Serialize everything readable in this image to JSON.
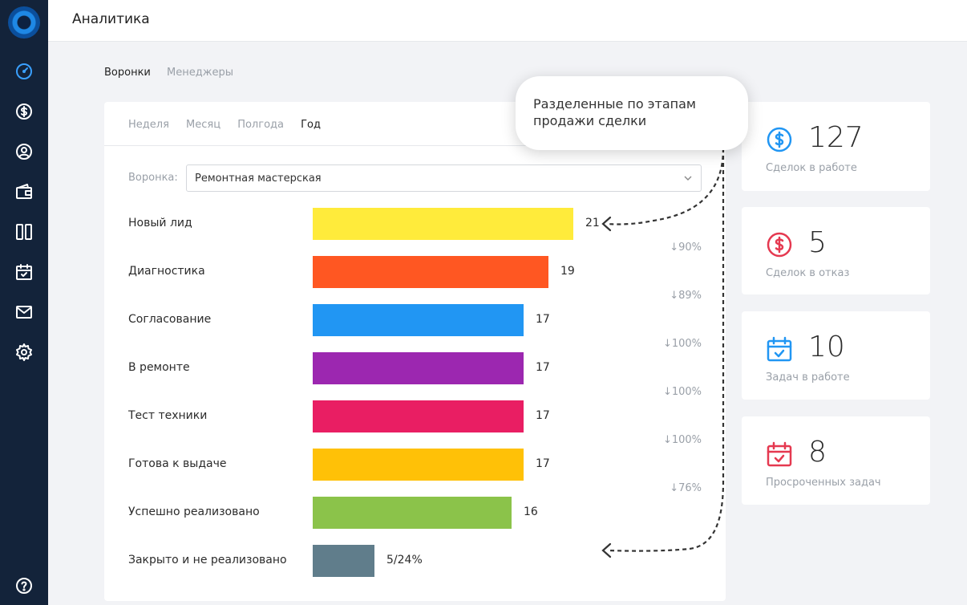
{
  "app": {
    "title": "Аналитика"
  },
  "sidebar": {
    "icons": [
      "dashboard-icon",
      "dollar-icon",
      "user-icon",
      "wallet-icon",
      "columns-icon",
      "calendar-icon",
      "mail-icon",
      "gear-icon",
      "help-icon"
    ]
  },
  "tabs": [
    {
      "label": "Воронки",
      "active": true
    },
    {
      "label": "Менеджеры",
      "active": false
    }
  ],
  "periods": [
    {
      "label": "Неделя",
      "selected": false
    },
    {
      "label": "Месяц",
      "selected": false
    },
    {
      "label": "Полгода",
      "selected": false
    },
    {
      "label": "Год",
      "selected": true
    }
  ],
  "funnel": {
    "label": "Воронка:",
    "selected": "Ремонтная мастерская"
  },
  "stages": [
    {
      "label": "Новый лид",
      "value": "21",
      "color": "#ffeb3b"
    },
    {
      "label": "Диагностика",
      "value": "19",
      "color": "#ff5722"
    },
    {
      "label": "Согласование",
      "value": "17",
      "color": "#2196f3"
    },
    {
      "label": "В ремонте",
      "value": "17",
      "color": "#9c27b0"
    },
    {
      "label": "Тест техники",
      "value": "17",
      "color": "#e91e63"
    },
    {
      "label": "Готова к выдаче",
      "value": "17",
      "color": "#ffc107"
    },
    {
      "label": "Успешно реализовано",
      "value": "16",
      "color": "#8bc34a"
    },
    {
      "label": "Закрыто и не реализовано",
      "value": "5/24%",
      "color": "#607d8b"
    }
  ],
  "conversions": [
    "↓90%",
    "↓89%",
    "↓100%",
    "↓100%",
    "↓100%",
    "↓76%"
  ],
  "cards": [
    {
      "value": "127",
      "label": "Сделок в работе",
      "icon": "dollar-icon",
      "color": "#2196f3"
    },
    {
      "value": "5",
      "label": "Сделок в отказ",
      "icon": "dollar-icon",
      "color": "#e53950"
    },
    {
      "value": "10",
      "label": "Задач в работе",
      "icon": "calendar-check-icon",
      "color": "#2196f3"
    },
    {
      "value": "8",
      "label": "Просроченных задач",
      "icon": "calendar-check-icon",
      "color": "#e53950"
    }
  ],
  "callout": {
    "text": "Разделенные по этапам продажи сделки"
  }
}
